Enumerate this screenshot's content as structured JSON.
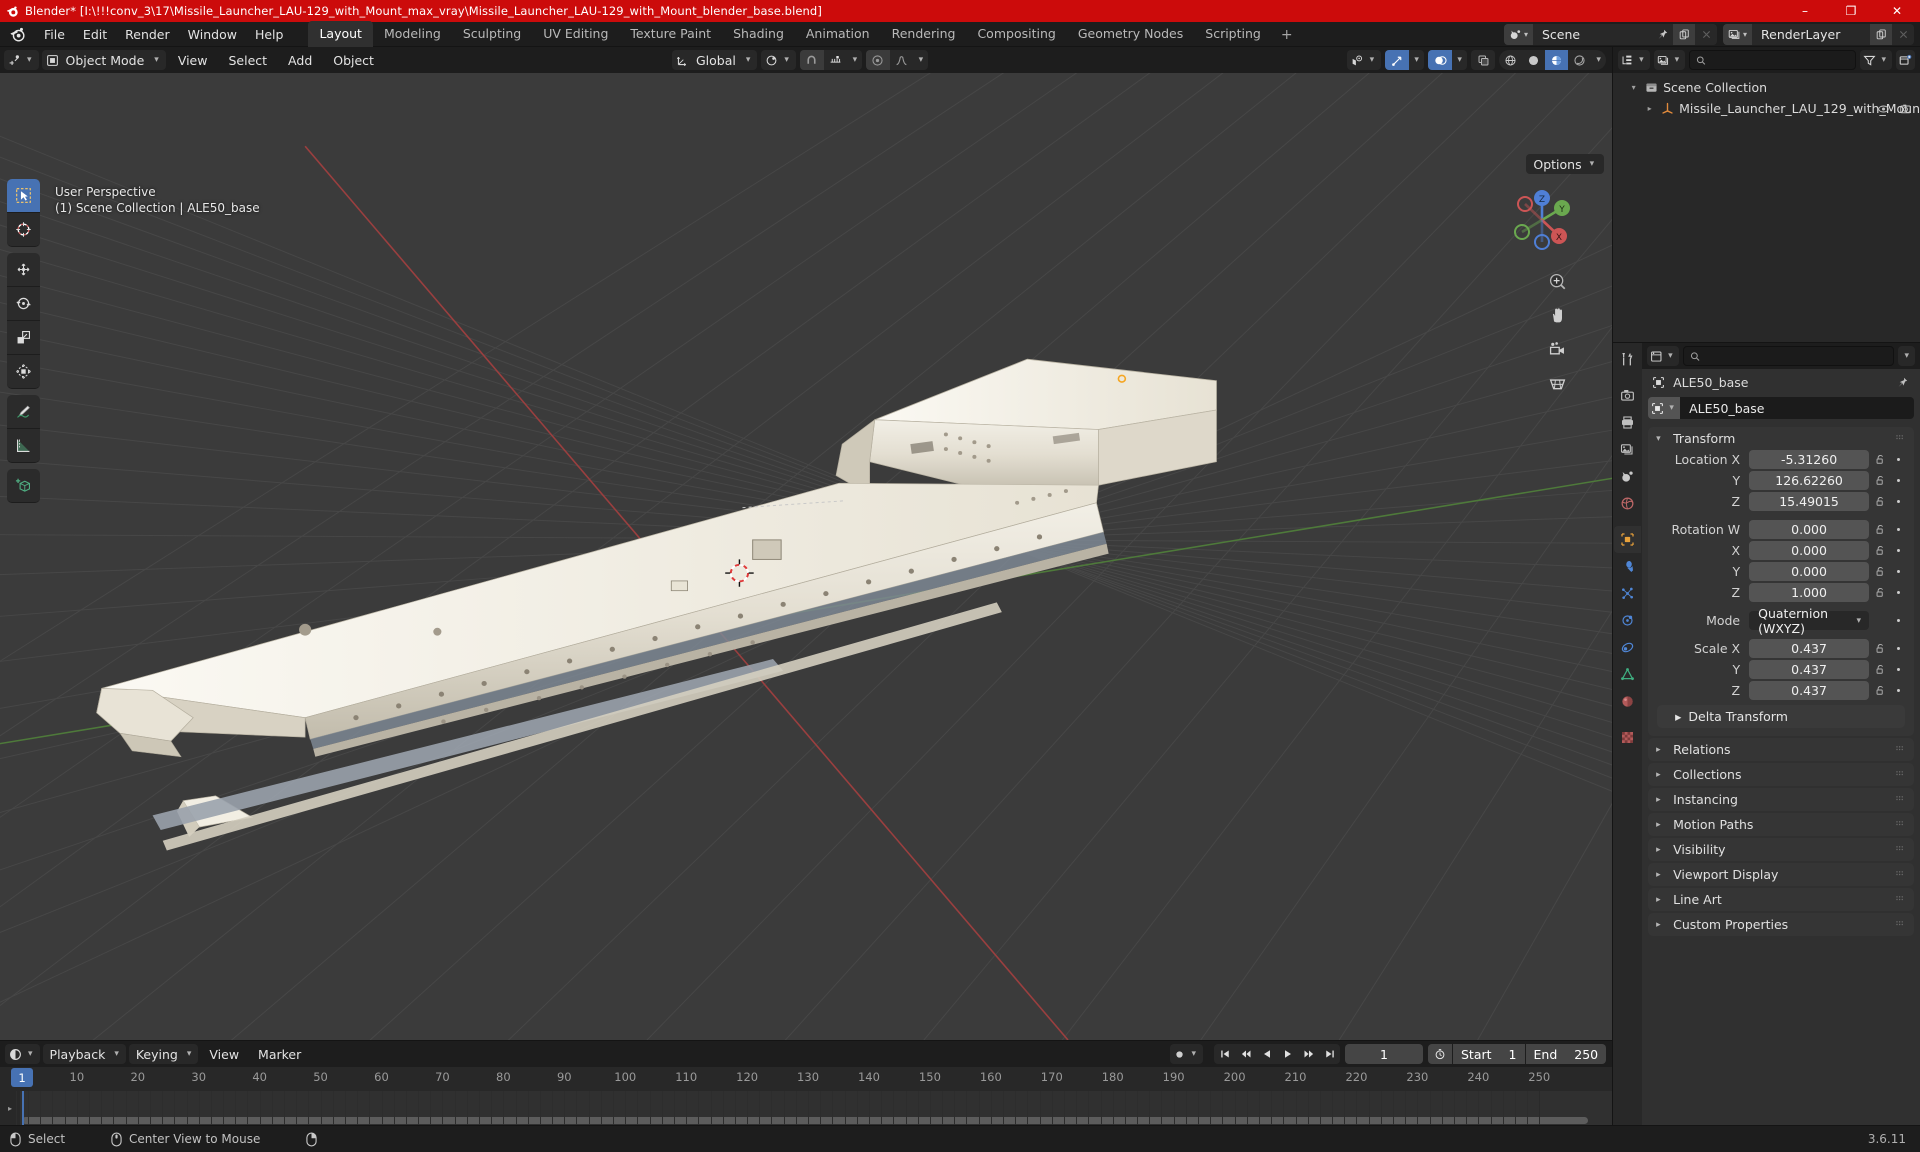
{
  "titlebar": {
    "text": "Blender* [I:\\!!!conv_3\\17\\Missile_Launcher_LAU-129_with_Mount_max_vray\\Missile_Launcher_LAU-129_with_Mount_blender_base.blend]",
    "minimize": "–",
    "maximize": "❐",
    "close": "✕",
    "accent": "#cc0b0b"
  },
  "topbar": {
    "menus": [
      "File",
      "Edit",
      "Render",
      "Window",
      "Help"
    ],
    "workspaces": [
      {
        "label": "Layout",
        "active": true
      },
      {
        "label": "Modeling",
        "active": false
      },
      {
        "label": "Sculpting",
        "active": false
      },
      {
        "label": "UV Editing",
        "active": false
      },
      {
        "label": "Texture Paint",
        "active": false
      },
      {
        "label": "Shading",
        "active": false
      },
      {
        "label": "Animation",
        "active": false
      },
      {
        "label": "Rendering",
        "active": false
      },
      {
        "label": "Compositing",
        "active": false
      },
      {
        "label": "Geometry Nodes",
        "active": false
      },
      {
        "label": "Scripting",
        "active": false
      }
    ],
    "add_workspace": "+",
    "scene_name": "Scene",
    "viewlayer_name": "RenderLayer"
  },
  "viewport_header": {
    "mode": "Object Mode",
    "menus": [
      "View",
      "Select",
      "Add",
      "Object"
    ],
    "transform_orientation": "Global",
    "options_label": "Options"
  },
  "viewport": {
    "overlay_line1": "User Perspective",
    "overlay_line2": "(1) Scene Collection | ALE50_base",
    "gizmo_axes": [
      "Z",
      "Y",
      "X"
    ],
    "background": "#3b3b3b",
    "grid_color": "#4d4d4d",
    "axis_x_color": "#9a3b3b",
    "axis_y_color": "#4e8a3b",
    "tools": [
      {
        "name": "tweak-tool",
        "active": true
      },
      {
        "name": "cursor-tool",
        "active": false
      },
      {
        "name": "move-tool",
        "active": false
      },
      {
        "name": "rotate-tool",
        "active": false
      },
      {
        "name": "scale-tool",
        "active": false
      },
      {
        "name": "transform-tool",
        "active": false
      },
      {
        "name": "annotate-tool",
        "active": false
      },
      {
        "name": "measure-tool",
        "active": false
      },
      {
        "name": "add-cube-tool",
        "active": false
      }
    ]
  },
  "outliner": {
    "search_placeholder": "",
    "rows": [
      {
        "label": "Scene Collection",
        "indent": 0,
        "type": "collection",
        "expanded": true
      },
      {
        "label": "Missile_Launcher_LAU_129_with_Moun",
        "indent": 1,
        "type": "object",
        "expanded": false
      }
    ]
  },
  "properties": {
    "search_placeholder": "",
    "breadcrumb": "ALE50_base",
    "id_name": "ALE50_base",
    "transform": {
      "title": "Transform",
      "rows": [
        {
          "label": "Location X",
          "value": "-5.31260"
        },
        {
          "label": "Y",
          "value": "126.62260"
        },
        {
          "label": "Z",
          "value": "15.49015"
        },
        {
          "label": "Rotation W",
          "value": "0.000",
          "group_start": true
        },
        {
          "label": "X",
          "value": "0.000"
        },
        {
          "label": "Y",
          "value": "0.000"
        },
        {
          "label": "Z",
          "value": "1.000"
        },
        {
          "label": "Mode",
          "value": "Quaternion (WXYZ)",
          "dropdown": true,
          "group_start": true
        },
        {
          "label": "Scale X",
          "value": "0.437",
          "group_start": true
        },
        {
          "label": "Y",
          "value": "0.437"
        },
        {
          "label": "Z",
          "value": "0.437"
        }
      ],
      "sub_panel": "Delta Transform"
    },
    "panels": [
      "Relations",
      "Collections",
      "Instancing",
      "Motion Paths",
      "Visibility",
      "Viewport Display",
      "Line Art",
      "Custom Properties"
    ]
  },
  "timeline": {
    "menus": [
      "Playback",
      "Keying",
      "View",
      "Marker"
    ],
    "current_frame": "1",
    "start_label": "Start",
    "start_value": "1",
    "end_label": "End",
    "end_value": "250",
    "ticks": [
      10,
      20,
      30,
      40,
      50,
      60,
      70,
      80,
      90,
      100,
      110,
      120,
      130,
      140,
      150,
      160,
      170,
      180,
      190,
      200,
      210,
      220,
      230,
      240,
      250
    ],
    "playhead_frame": 1
  },
  "statusbar": {
    "items": [
      {
        "icon": "mouse-left-icon",
        "label": "Select"
      },
      {
        "icon": "mouse-middle-icon",
        "label": "Center View to Mouse"
      },
      {
        "icon": "mouse-right-icon",
        "label": ""
      }
    ],
    "version": "3.6.11"
  }
}
